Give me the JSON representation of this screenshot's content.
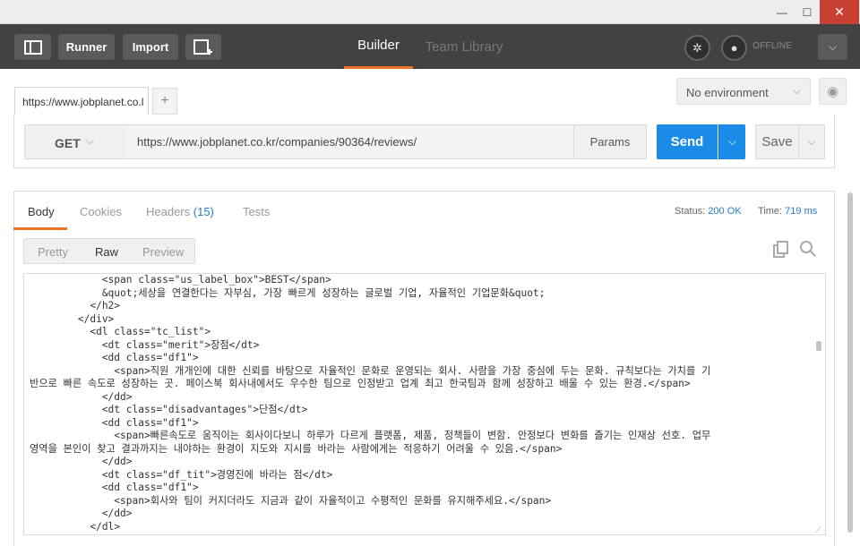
{
  "window": {
    "minimize": "—",
    "maximize": "☐",
    "close": "✕"
  },
  "header": {
    "runner": "Runner",
    "import": "Import",
    "tabs": [
      "Builder",
      "Team Library"
    ],
    "offline": "OFFLINE"
  },
  "tabbar": {
    "tab_label": "https://www.jobplanet.co.l",
    "add": "+",
    "environment": "No environment"
  },
  "request": {
    "method": "GET",
    "url": "https://www.jobplanet.co.kr/companies/90364/reviews/",
    "params": "Params",
    "send": "Send",
    "save": "Save"
  },
  "response": {
    "tabs": {
      "body": "Body",
      "cookies": "Cookies",
      "headers": "Headers",
      "headers_count": "(15)",
      "tests": "Tests"
    },
    "status_label": "Status:",
    "status_value": "200 OK",
    "time_label": "Time:",
    "time_value": "719 ms",
    "views": [
      "Pretty",
      "Raw",
      "Preview"
    ],
    "lines": [
      "            <span class=\"us_label_box\">BEST</span>",
      "            &quot;세상을 연결한다는 자부심, 가장 빠르게 성장하는 글로벌 기업, 자율적인 기업문화&quot;",
      "          </h2>",
      "        </div>",
      "          <dl class=\"tc_list\">",
      "            <dt class=\"merit\">장점</dt>",
      "            <dd class=\"df1\">",
      "              <span>직원 개개인에 대한 신뢰를 바탕으로 자율적인 문화로 운영되는 회사. 사람을 가장 중심에 두는 문화. 규칙보다는 가치를 기",
      "반으로 빠른 속도로 성장하는 곳. 페이스북 회사내에서도 우수한 팀으로 인정받고 업계 최고 한국팀과 함께 성장하고 배울 수 있는 환경.</span>",
      "            </dd>",
      "            <dt class=\"disadvantages\">단점</dt>",
      "            <dd class=\"df1\">",
      "              <span>빠른속도로 움직이는 회사이다보니 하루가 다르게 플랫폼, 제품, 정책들이 변함. 안정보다 변화를 즐기는 인재상 선호. 업무",
      "영역을 본인이 찾고 결과까지는 내야하는 환경이 지도와 지시를 바라는 사람에게는 적응하기 어려울 수 있음.</span>",
      "            </dd>",
      "            <dt class=\"df_tit\">경영진에 바라는 점</dt>",
      "            <dd class=\"df1\">",
      "              <span>회사와 팀이 커지더라도 지금과 같이 자율적이고 수평적인 문화를 유지해주세요.</span>",
      "            </dd>",
      "          </dl>"
    ]
  }
}
